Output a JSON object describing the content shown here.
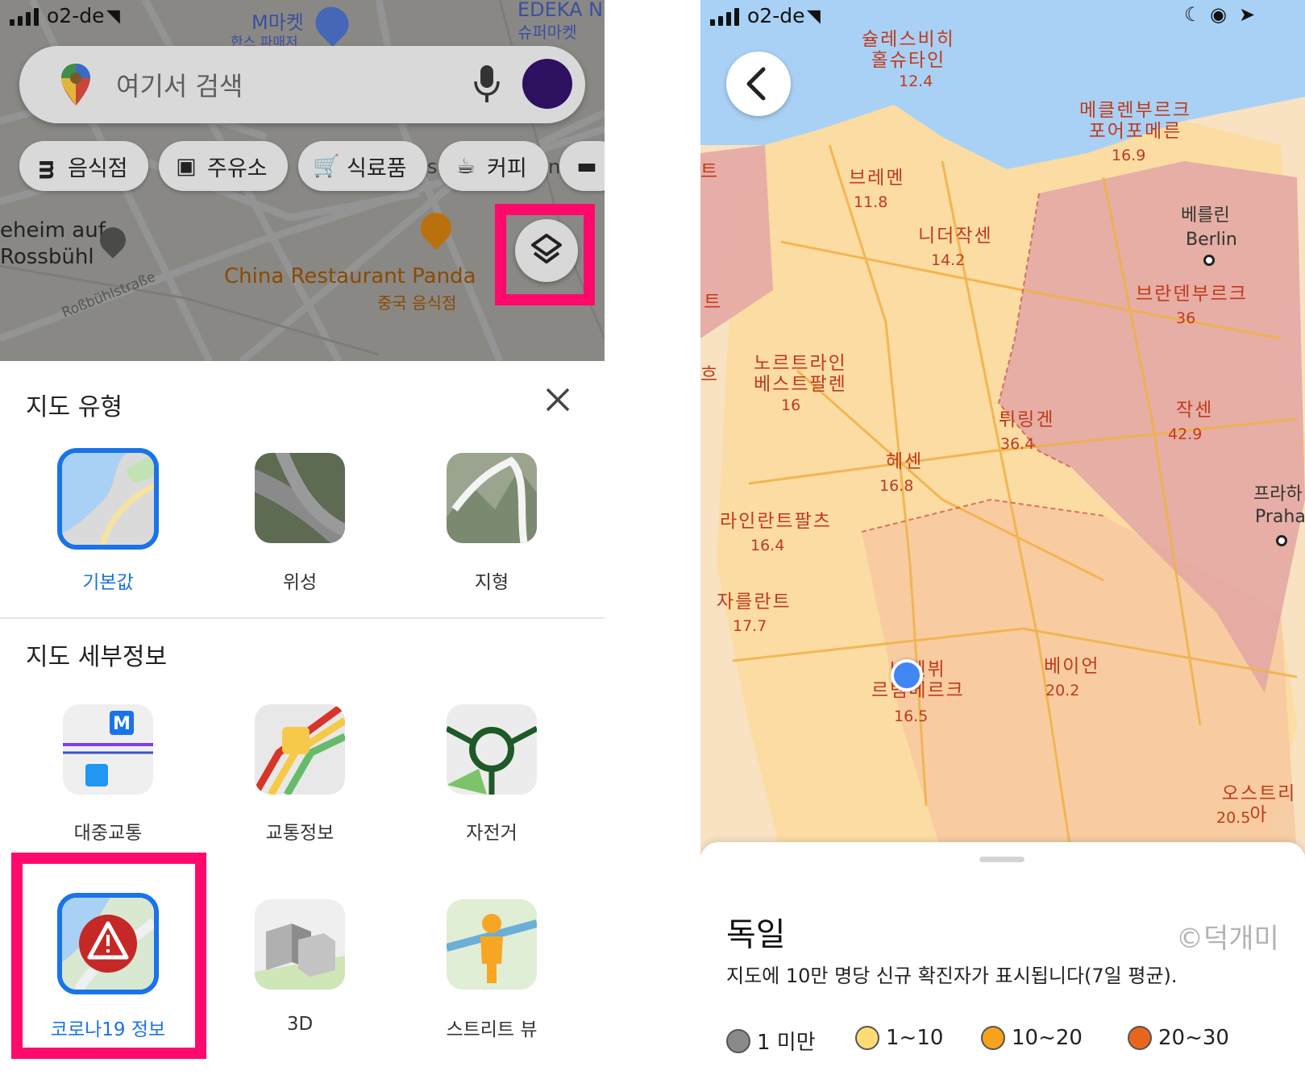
{
  "left": {
    "status": {
      "carrier": "o2-de"
    },
    "map_labels": {
      "top_store": "M마켓",
      "top_store2": "한스 파매저",
      "edeka": "EDEKA N",
      "edeka_sub": "슈퍼마켓",
      "heim": "eheim auf\nRossbühl",
      "restaurant": "China Restaurant Panda",
      "restaurant_sub": "중국 음식점",
      "street": "Roßbühlstraße"
    },
    "search": {
      "placeholder": "여기서 검색"
    },
    "chips": [
      {
        "icon": "restaurant-icon",
        "label": "음식점"
      },
      {
        "icon": "gas-station-icon",
        "label": "주유소"
      },
      {
        "icon": "cart-icon",
        "label": "식료품"
      },
      {
        "icon": "coffee-icon",
        "label": "커피"
      },
      {
        "icon": "hotel-icon",
        "label": ""
      }
    ],
    "chip_overflow": {
      "a": "s",
      "b": "n"
    },
    "sheet": {
      "map_type_title": "지도 유형",
      "map_types": [
        {
          "label": "기본값",
          "selected": true
        },
        {
          "label": "위성",
          "selected": false
        },
        {
          "label": "지형",
          "selected": false
        }
      ],
      "details_title": "지도 세부정보",
      "details": [
        {
          "label": "대중교통"
        },
        {
          "label": "교통정보"
        },
        {
          "label": "자전거"
        },
        {
          "label": "코로나19 정보",
          "selected": true
        },
        {
          "label": "3D"
        },
        {
          "label": "스트리트 뷰"
        }
      ]
    },
    "colors": {
      "highlight": "#ff0a6c",
      "accent": "#1a73e8"
    }
  },
  "right": {
    "status": {
      "carrier": "o2-de"
    },
    "regions": [
      {
        "name": "슐레스비히\n홀슈타인",
        "value": "12.4"
      },
      {
        "name": "메클렌부르크\n포어포메른",
        "value": "16.9"
      },
      {
        "name": "브레멘",
        "value": "11.8"
      },
      {
        "name": "니더작센",
        "value": "14.2"
      },
      {
        "name": "브란덴부르크",
        "value": "36"
      },
      {
        "name": "노르트라인\n베스트팔렌",
        "value": "16"
      },
      {
        "name": "튀링겐",
        "value": "36.4"
      },
      {
        "name": "작센",
        "value": "42.9"
      },
      {
        "name": "헤센",
        "value": "16.8"
      },
      {
        "name": "라인란트팔츠",
        "value": "16.4"
      },
      {
        "name": "자를란트",
        "value": "17.7"
      },
      {
        "name": "바덴뷔\n르템베르크",
        "value": "16.5"
      },
      {
        "name": "베이언",
        "value": "20.2"
      },
      {
        "name": "오스트리아",
        "value": "20.5"
      }
    ],
    "cities": {
      "berlin_ko": "베를린",
      "berlin_en": "Berlin",
      "praha_ko": "프라하",
      "praha_en": "Praha"
    },
    "edge_labels": {
      "a": "트",
      "b": "트",
      "c": "흐"
    },
    "sheet": {
      "country": "독일",
      "description": "지도에 10만 명당 신규 확진자가 표시됩니다(7일 평균).",
      "watermark": "©덕개미",
      "legend": [
        {
          "label": "1 미만",
          "color": "#8a8a8a"
        },
        {
          "label": "1~10",
          "color": "#fddc73"
        },
        {
          "label": "10~20",
          "color": "#f7a21b"
        },
        {
          "label": "20~30",
          "color": "#e8651e"
        }
      ]
    }
  }
}
